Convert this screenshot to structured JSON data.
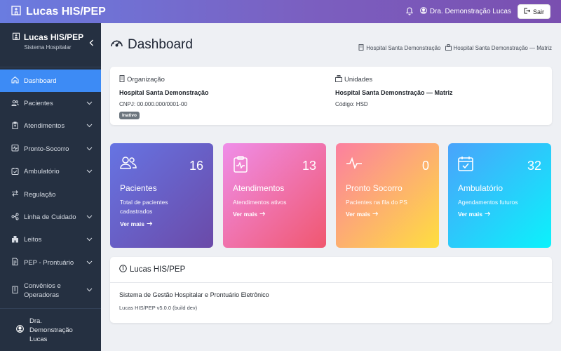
{
  "topbar": {
    "brand": "Lucas HIS/PEP",
    "user_name": "Dra. Demonstração Lucas",
    "logout_label": "Sair"
  },
  "sidebar": {
    "title": "Lucas HIS/PEP",
    "subtitle": "Sistema Hospitalar",
    "items": [
      {
        "label": "Dashboard",
        "icon": "home-icon",
        "active": true,
        "expandable": false
      },
      {
        "label": "Pacientes",
        "icon": "users-icon",
        "expandable": true
      },
      {
        "label": "Atendimentos",
        "icon": "clipboard-icon",
        "expandable": true
      },
      {
        "label": "Pronto-Socorro",
        "icon": "pulse-icon",
        "expandable": true
      },
      {
        "label": "Ambulatório",
        "icon": "calendar-check-icon",
        "expandable": true
      },
      {
        "label": "Regulação",
        "icon": "arrows-exchange-icon",
        "expandable": false
      },
      {
        "label": "Linha de Cuidado",
        "icon": "flow-icon",
        "expandable": true
      },
      {
        "label": "Leitos",
        "icon": "hospital-icon",
        "expandable": true
      },
      {
        "label": "PEP - Prontuário",
        "icon": "document-icon",
        "expandable": true
      },
      {
        "label": "Convênios e Operadoras",
        "icon": "building-icon",
        "expandable": true
      }
    ],
    "footer_user": "Dra. Demonstração Lucas"
  },
  "page": {
    "title": "Dashboard",
    "breadcrumbs": [
      "Hospital Santa Demonstração",
      "Hospital Santa Demonstração — Matriz"
    ]
  },
  "organization": {
    "header": "Organização",
    "name": "Hospital Santa Demonstração",
    "cnpj": "CNPJ: 00.000.000/0001-00",
    "status": "Inativo"
  },
  "units": {
    "header": "Unidades",
    "name": "Hospital Santa Demonstração — Matriz",
    "code": "Código: HSD"
  },
  "stats": [
    {
      "title": "Pacientes",
      "value": "16",
      "desc": "Total de pacientes cadastrados",
      "more": "Ver mais"
    },
    {
      "title": "Atendimentos",
      "value": "13",
      "desc": "Atendimentos ativos",
      "more": "Ver mais"
    },
    {
      "title": "Pronto Socorro",
      "value": "0",
      "desc": "Pacientes na fila do PS",
      "more": "Ver mais"
    },
    {
      "title": "Ambulatório",
      "value": "32",
      "desc": "Agendamentos futuros",
      "more": "Ver mais"
    }
  ],
  "about": {
    "title": "Lucas HIS/PEP",
    "description": "Sistema de Gestão Hospitalar e Prontuário Eletrônico",
    "version": "Lucas HIS/PEP v5.0.0 (build dev)"
  },
  "colors": {
    "accent": "#3d8bf5",
    "sidebar_bg": "#253041"
  }
}
